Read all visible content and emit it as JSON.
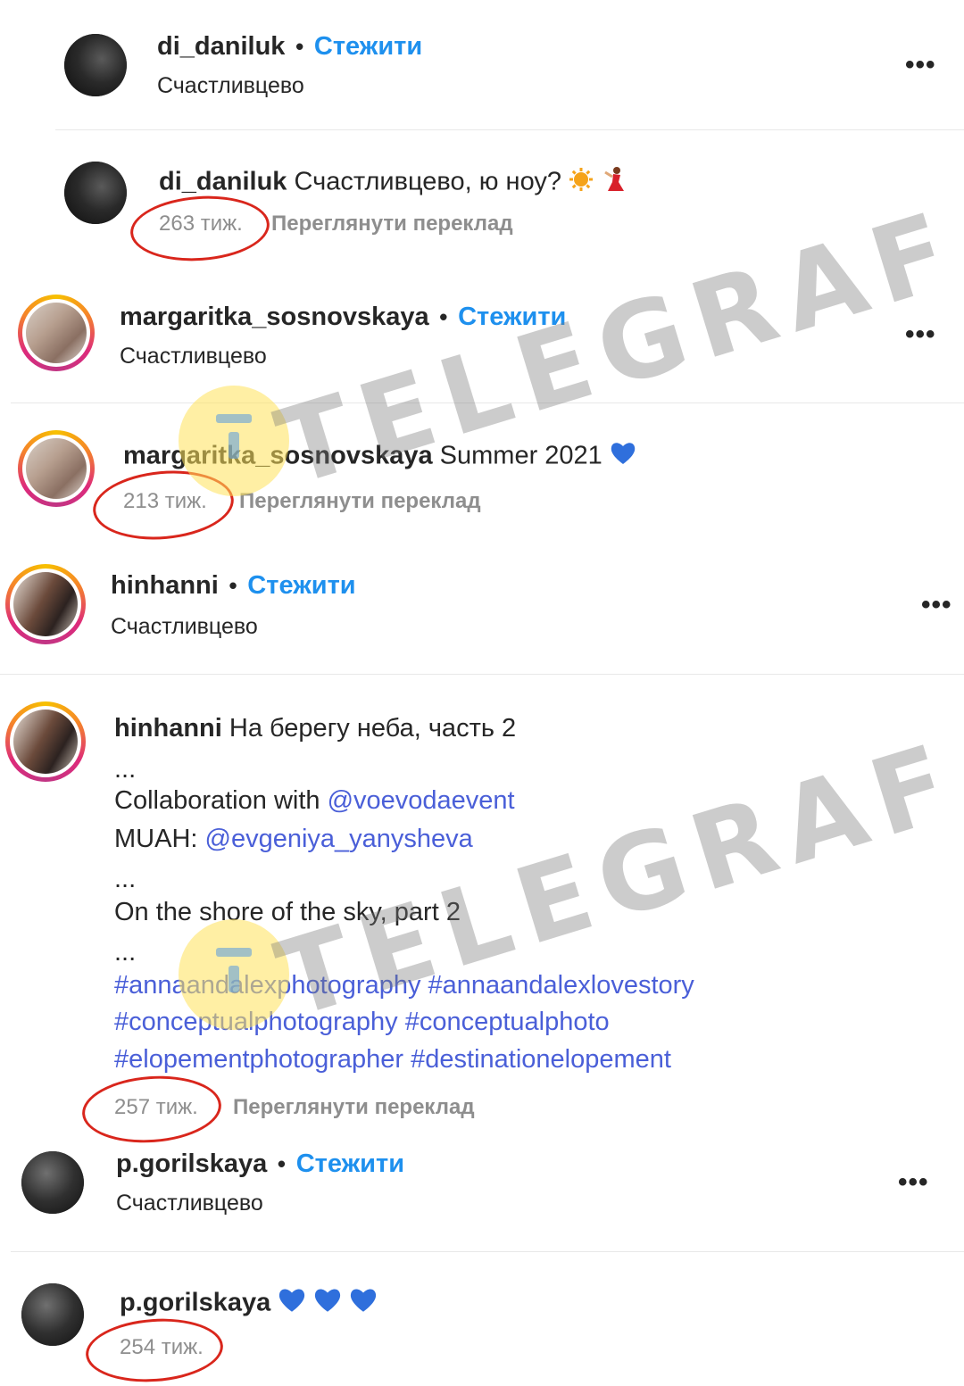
{
  "follow_label": "Стежити",
  "translate_label": "Переглянути переклад",
  "more_label": "•••",
  "watermark": "TELEGRAF",
  "posts": [
    {
      "username": "di_daniluk",
      "location": "Счастливцево",
      "caption": "Счастливцево, ю ноу?",
      "time": "263 тиж."
    },
    {
      "username": "margaritka_sosnovskaya",
      "location": "Счастливцево",
      "caption": "Summer 2021",
      "time": "213 тиж."
    },
    {
      "username": "hinhanni",
      "location": "Счастливцево",
      "caption": "На берегу неба, часть 2",
      "time": "257 тиж.",
      "body": {
        "ellipsis": "...",
        "collab_prefix": "Collaboration with ",
        "collab_mention": "@voevodaevent",
        "muah_prefix": "MUAH: ",
        "muah_mention": "@evgeniya_yanysheva",
        "english_title": "On the shore of the sky, part 2",
        "hashtags": [
          "#annaandalexphotography #annaandalexlovestory",
          "#conceptualphotography #conceptualphoto",
          "#elopementphotographer #destinationelopement"
        ]
      }
    },
    {
      "username": "p.gorilskaya",
      "location": "Счастливцево",
      "caption": "",
      "time": "254 тиж."
    }
  ]
}
